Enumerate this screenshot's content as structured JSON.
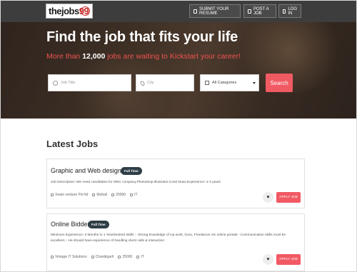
{
  "header": {
    "logo_text_main": "thejobs",
    "logo_text_num": "99",
    "nav": [
      {
        "label": "SUBMIT YOUR RESUME",
        "icon": "upload-icon"
      },
      {
        "label": "POST A JOB",
        "icon": "briefcase-icon"
      },
      {
        "label": "LOG IN",
        "icon": "login-icon"
      }
    ]
  },
  "hero": {
    "title": "Find the job that fits your life",
    "subtitle_prefix": "More than ",
    "subtitle_count": "12,000",
    "subtitle_suffix": " jobs are waiting to Kickstart your career!",
    "job_title_placeholder": "Job Title",
    "city_placeholder": "City",
    "category_selected": "All Categories",
    "search_label": "Search"
  },
  "latest": {
    "title": "Latest Jobs",
    "jobs": [
      {
        "title": "Graphic and Web designer",
        "type": "Full Time",
        "description": "Job Description:-We need candidates for MNC company.Photoshop.Illustrator.Corel Draw Experience:-1-3 years",
        "company": "Xeam venture Pvt ltd",
        "location": "Mohali",
        "salary": "20000",
        "category": "IT",
        "apply_label": "APPLY JOB"
      },
      {
        "title": "Online Bidder",
        "type": "Full Time",
        "description": "Minimum Experience: 6 Months to 1 YearDesired Skills :- Strong knowledge of Up work, Guru, Freelancer etc online portals:- Communication skills must be excellent.:- He should have experience of handling client calls & interaction.",
        "company": "Vintage IT Solutions",
        "location": "Chandigarh",
        "salary": "25000",
        "category": "IT",
        "apply_label": "APPLY JOB"
      }
    ]
  }
}
